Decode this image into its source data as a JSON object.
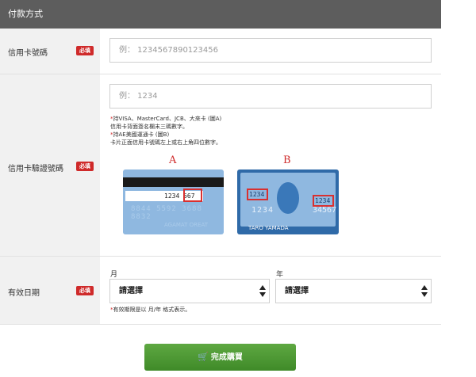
{
  "header": {
    "title": "付款方式"
  },
  "card_number": {
    "label": "信用卡號碼",
    "required": "必填",
    "placeholder": "例： 1234567890123456"
  },
  "cvv": {
    "label": "信用卡驗證號碼",
    "required": "必填",
    "placeholder": "例： 1234",
    "notes": [
      "*持VISA、MasterCard、JCB、大來卡 (圖A)",
      "信用卡背面簽名欄末三碼數字。",
      "*持AE美國運通卡 (圖B)",
      "卡片正面信用卡號碼左上或右上角四位數字。"
    ],
    "card_a": {
      "letter": "A",
      "number": "1234",
      "code": "567",
      "embossed": "8844 5592 3688 8832",
      "name": "AGAMAT OREAT"
    },
    "card_b": {
      "letter": "B",
      "code_left": "1234",
      "code_right": "1234",
      "big_left": "1234",
      "big_right": "34567",
      "name": "TARO YAMADA"
    }
  },
  "expiry": {
    "label": "有效日期",
    "required": "必填",
    "month_label": "月",
    "year_label": "年",
    "month_value": "請選擇",
    "year_value": "請選擇",
    "note": "*有效期限是以 月/年 格式表示。"
  },
  "submit": {
    "icon": "cart-icon",
    "label": "完成購買"
  },
  "colors": {
    "header": "#5d5d5d",
    "required": "#cf2a2a",
    "submit": "#4e9a35"
  }
}
